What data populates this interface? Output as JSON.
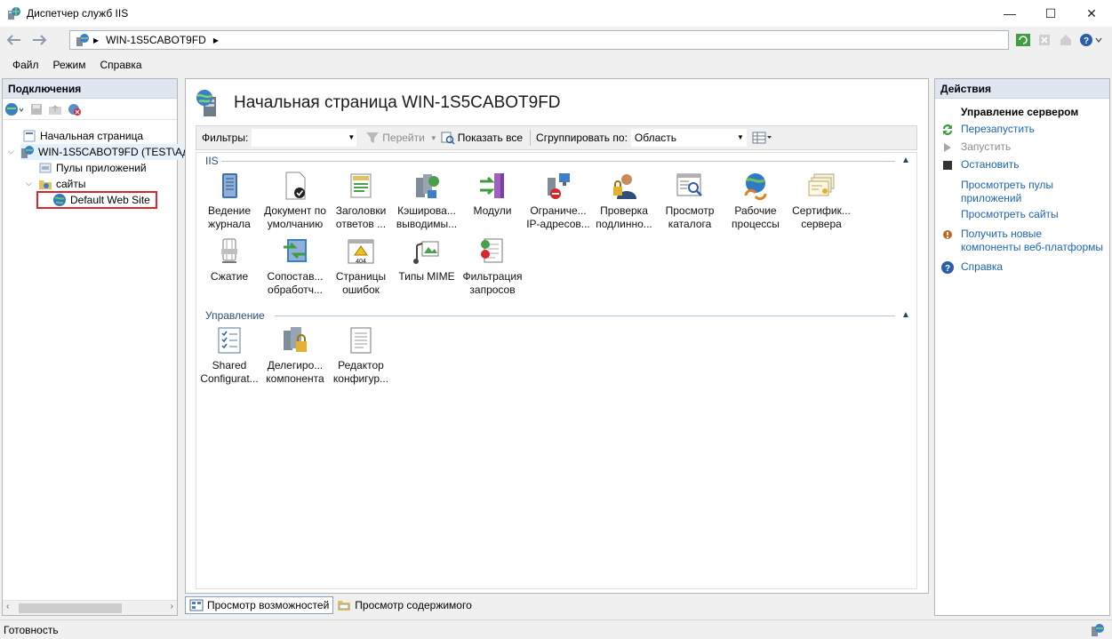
{
  "window": {
    "title": "Диспетчер служб IIS",
    "buttons": {
      "minimize": "—",
      "maximize": "☐",
      "close": "✕"
    }
  },
  "address": {
    "path": "WIN-1S5CABOT9FD"
  },
  "menu": [
    {
      "label": "Файл"
    },
    {
      "label": "Режим"
    },
    {
      "label": "Справка"
    }
  ],
  "connections": {
    "header": "Подключения",
    "tree": [
      {
        "label": "Начальная страница",
        "icon": "home-page-icon"
      },
      {
        "label": "WIN-1S5CABOT9FD (TEST\\Ад",
        "icon": "server-icon"
      },
      {
        "label": "Пулы приложений",
        "icon": "app-pools-icon"
      },
      {
        "label": "сайты",
        "icon": "sites-folder-icon"
      },
      {
        "label": "Default Web Site",
        "icon": "globe-icon"
      }
    ]
  },
  "center": {
    "title": "Начальная страница WIN-1S5CABOT9FD",
    "filter": {
      "label": "Фильтры:",
      "go_label": "Перейти",
      "show_all_label": "Показать все",
      "group_label": "Сгруппировать по:",
      "group_value": "Область"
    },
    "sections": [
      {
        "name": "IIS",
        "features": [
          {
            "label1": "Ведение",
            "label2": "журнала",
            "icon": "logging-icon"
          },
          {
            "label1": "Документ по",
            "label2": "умолчанию",
            "icon": "default-document-icon"
          },
          {
            "label1": "Заголовки",
            "label2": "ответов ...",
            "icon": "http-headers-icon"
          },
          {
            "label1": "Кэширова...",
            "label2": "выводимы...",
            "icon": "output-caching-icon"
          },
          {
            "label1": "Модули",
            "label2": "",
            "icon": "modules-icon"
          },
          {
            "label1": "Ограниче...",
            "label2": "IP-адресов...",
            "icon": "ip-restrictions-icon"
          },
          {
            "label1": "Проверка",
            "label2": "подлинно...",
            "icon": "authentication-icon"
          },
          {
            "label1": "Просмотр",
            "label2": "каталога",
            "icon": "directory-browsing-icon"
          },
          {
            "label1": "Рабочие",
            "label2": "процессы",
            "icon": "worker-processes-icon"
          },
          {
            "label1": "Сертифик...",
            "label2": "сервера",
            "icon": "server-certificates-icon"
          },
          {
            "label1": "Сжатие",
            "label2": "",
            "icon": "compression-icon"
          },
          {
            "label1": "Сопостав...",
            "label2": "обработч...",
            "icon": "handler-mappings-icon"
          },
          {
            "label1": "Страницы",
            "label2": "ошибок",
            "icon": "error-pages-icon"
          },
          {
            "label1": "Типы MIME",
            "label2": "",
            "icon": "mime-types-icon"
          },
          {
            "label1": "Фильтрация",
            "label2": "запросов",
            "icon": "request-filtering-icon"
          }
        ]
      },
      {
        "name": "Управление",
        "features": [
          {
            "label1": "Shared",
            "label2": "Configurat...",
            "icon": "shared-config-icon"
          },
          {
            "label1": "Делегиро...",
            "label2": "компонента",
            "icon": "feature-delegation-icon"
          },
          {
            "label1": "Редактор",
            "label2": "конфигур...",
            "icon": "config-editor-icon"
          }
        ]
      }
    ],
    "error_badge": "404"
  },
  "view_tabs": {
    "features_view": "Просмотр возможностей",
    "content_view": "Просмотр содержимого"
  },
  "actions": {
    "header": "Действия",
    "group": "Управление сервером",
    "restart": "Перезапустить",
    "start": "Запустить",
    "stop": "Остановить",
    "view_pools_1": "Просмотреть пулы",
    "view_pools_2": "приложений",
    "view_sites": "Просмотреть сайты",
    "get_new_1": "Получить новые",
    "get_new_2": "компоненты веб-платформы",
    "help": "Справка"
  },
  "status": {
    "text": "Готовность"
  },
  "colors": {
    "accent": "#1c64b4",
    "highlight_border": "#d9262c",
    "pane_header": "#dfe6ef"
  }
}
